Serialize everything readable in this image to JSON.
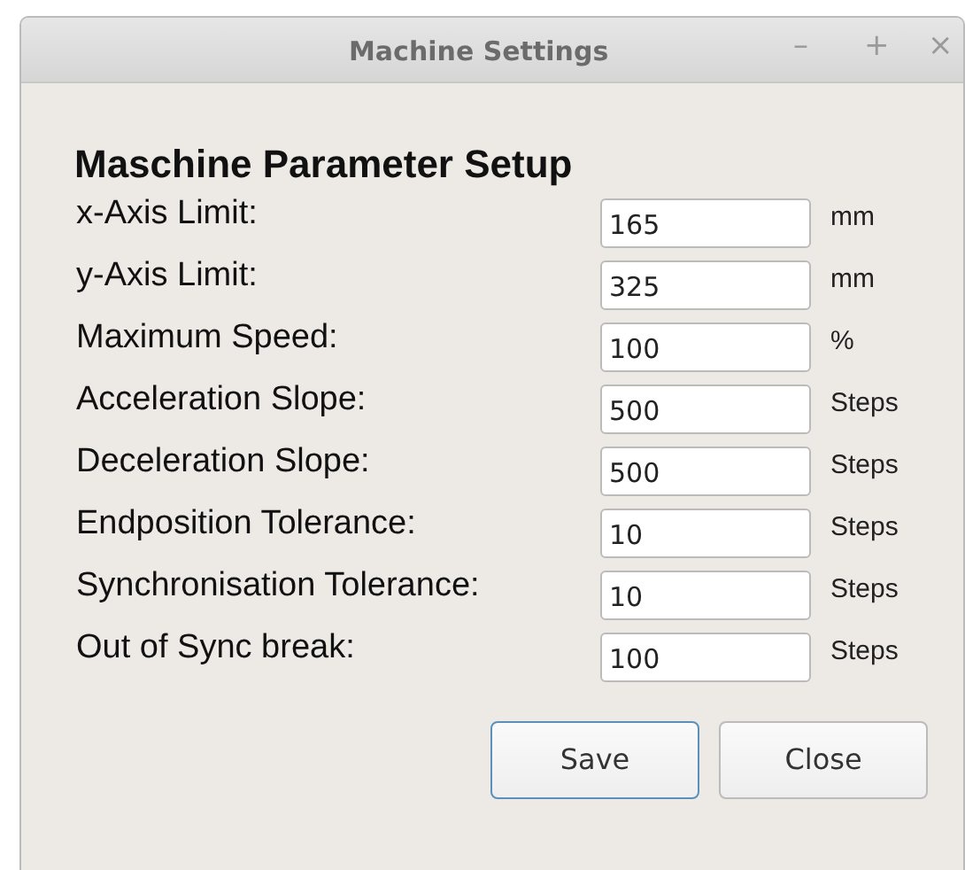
{
  "window": {
    "title": "Machine Settings",
    "controls": [
      "–",
      "+",
      "×"
    ]
  },
  "heading": "Maschine Parameter Setup",
  "fields": [
    {
      "label": "x-Axis Limit:",
      "value": "165",
      "unit": "mm"
    },
    {
      "label": "y-Axis Limit:",
      "value": "325",
      "unit": "mm"
    },
    {
      "label": "Maximum Speed:",
      "value": "100",
      "unit": "%"
    },
    {
      "label": "Acceleration Slope:",
      "value": "500",
      "unit": "Steps"
    },
    {
      "label": "Deceleration Slope:",
      "value": "500",
      "unit": "Steps"
    },
    {
      "label": "Endposition Tolerance:",
      "value": "10",
      "unit": "Steps"
    },
    {
      "label": "Synchronisation Tolerance:",
      "value": "10",
      "unit": "Steps"
    },
    {
      "label": "Out of Sync break:",
      "value": "100",
      "unit": "Steps"
    }
  ],
  "buttons": [
    {
      "label": "Save",
      "focused": true
    },
    {
      "label": "Close",
      "focused": false
    }
  ]
}
